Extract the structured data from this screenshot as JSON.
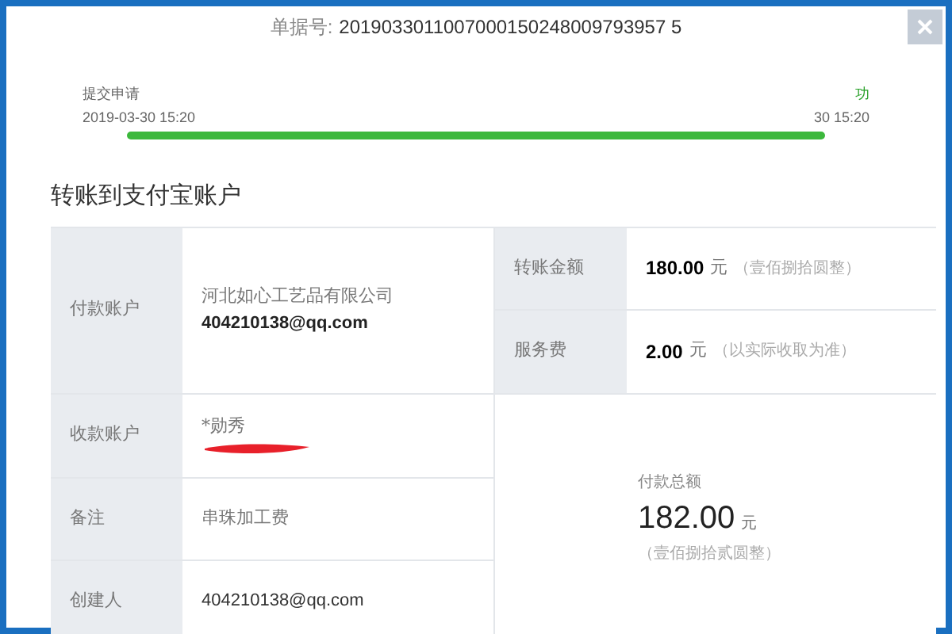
{
  "header": {
    "order_label": "单据号:",
    "order_number": "2019033011007000150248009793957 5"
  },
  "steps": [
    {
      "label": "提交申请",
      "time": "2019-03-30 15:20"
    },
    {
      "label": "功",
      "time": "30 15:20"
    }
  ],
  "title": "转账到支付宝账户",
  "payer": {
    "label": "付款账户",
    "name": "河北如心工艺品有限公司",
    "account": "404210138@qq.com"
  },
  "amount": {
    "label": "转账金额",
    "value": "180.00",
    "unit": "元",
    "words": "（壹佰捌拾圆整）"
  },
  "fee": {
    "label": "服务费",
    "value": "2.00",
    "unit": "元",
    "note": "（以实际收取为准）"
  },
  "payee": {
    "label": "收款账户",
    "name": "*勋秀",
    "redacted": true
  },
  "remark": {
    "label": "备注",
    "value": "串珠加工费"
  },
  "creator": {
    "label": "创建人",
    "value": "404210138@qq.com"
  },
  "total": {
    "label": "付款总额",
    "value": "182.00",
    "unit": "元",
    "words": "（壹佰捌拾贰圆整）"
  }
}
